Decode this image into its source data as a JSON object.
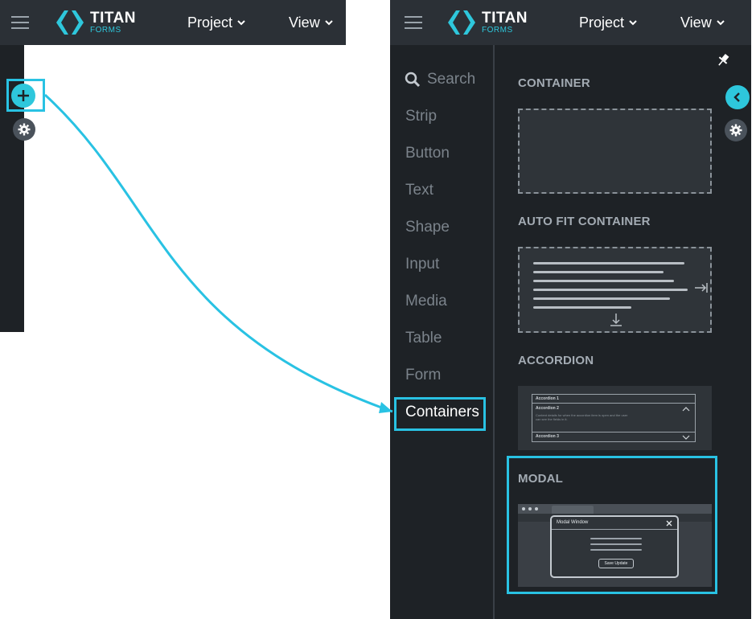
{
  "app": {
    "logo_title": "TITAN",
    "logo_sub": "FORMS",
    "menus": [
      "Project",
      "View"
    ]
  },
  "categories": {
    "search_label": "Search",
    "items": [
      "Strip",
      "Button",
      "Text",
      "Shape",
      "Input",
      "Media",
      "Table",
      "Form",
      "Containers"
    ],
    "active": "Containers"
  },
  "sections": {
    "container": "CONTAINER",
    "auto_fit": "AUTO FIT CONTAINER",
    "accordion": "ACCORDION",
    "modal": "MODAL"
  },
  "accordion_preview": {
    "item1": "Accordion 1",
    "item2": "Accordion 2",
    "item2_body": "Content details for when the accordion item is open and the user can see the fields in it.",
    "item3": "Accordion 3"
  },
  "modal_preview": {
    "title": "Modal Window",
    "button": "Save Update"
  },
  "colors": {
    "accent": "#2ec7dc",
    "highlight": "#29c2e3",
    "topbar": "#2b3036",
    "panel": "#1e2226"
  }
}
